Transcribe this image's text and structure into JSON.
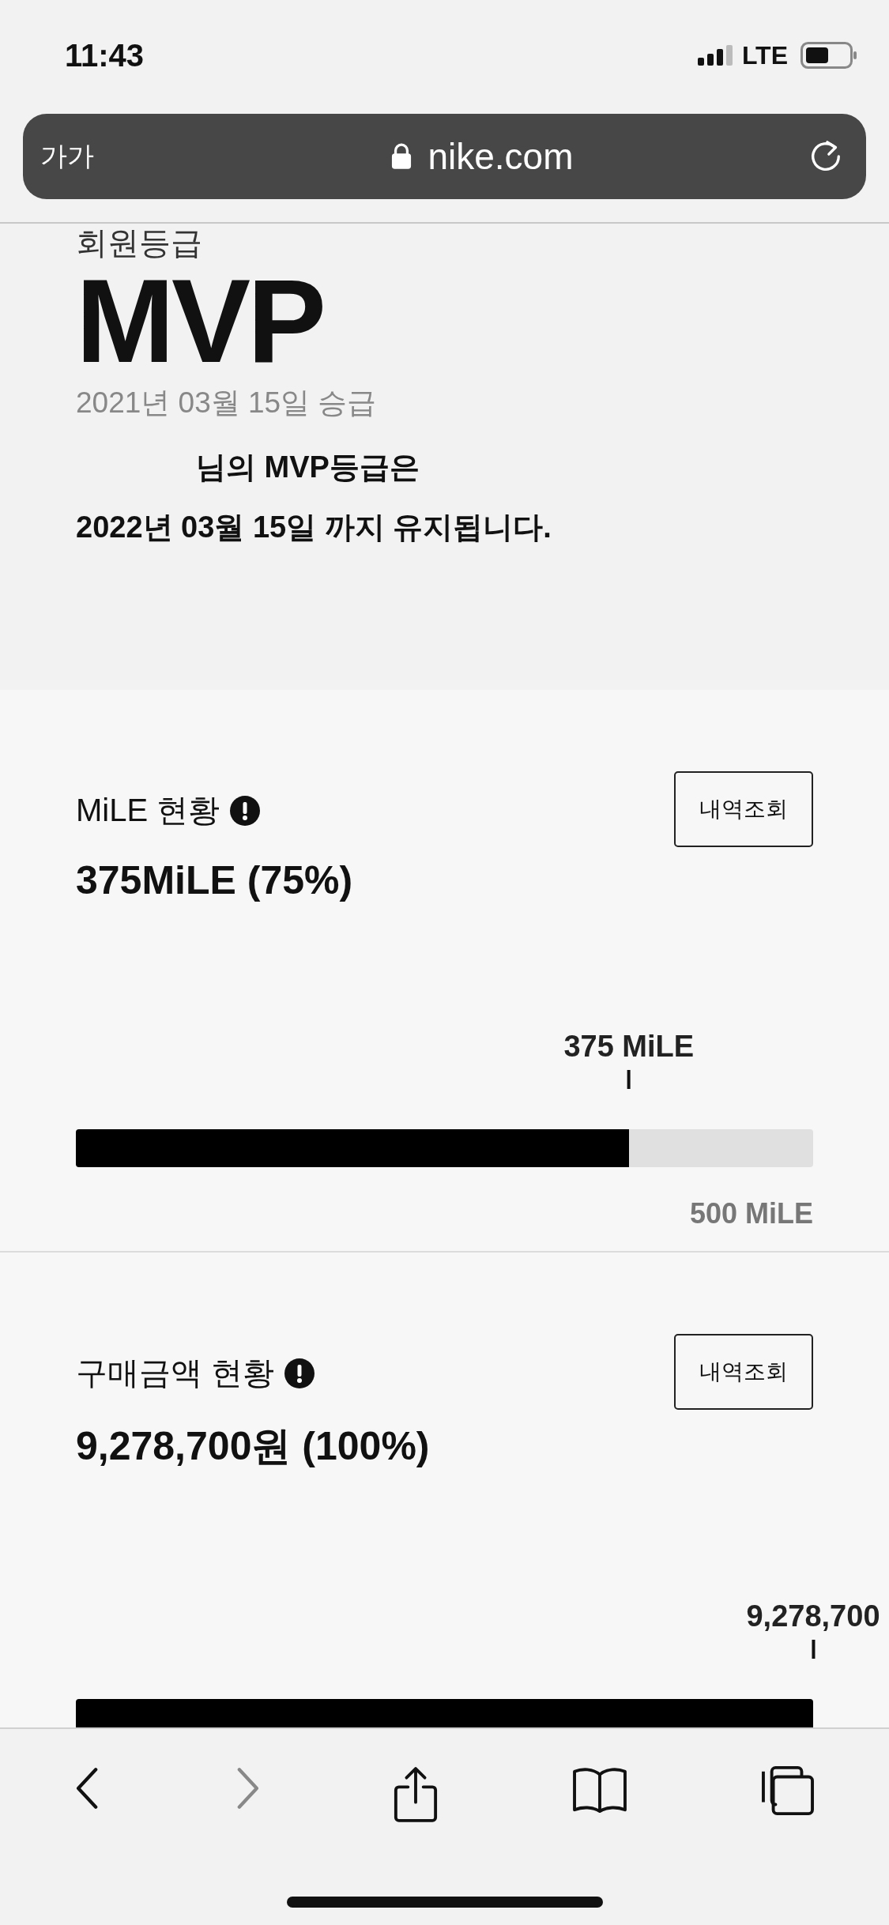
{
  "status_bar": {
    "time": "11:43",
    "network": "LTE"
  },
  "address_bar": {
    "text_size": "가가",
    "url": "nike.com"
  },
  "membership": {
    "label": "회원등급",
    "grade": "MVP",
    "promoted": "2021년 03월 15일 승급",
    "notice": "님의 MVP등급은\n2022년 03월 15일 까지 유지됩니다."
  },
  "meters": [
    {
      "title": "MiLE 현황",
      "button": "내역조회",
      "amount": "375MiLE (75%)",
      "marker": "375 MiLE",
      "level": 0.75,
      "max": "500 MiLE"
    },
    {
      "title": "구매금액 현황",
      "button": "내역조회",
      "amount": "9,278,700원 (100%)",
      "marker": "9,278,700",
      "level": 1
    }
  ],
  "toolbar": [
    {
      "kind": "back",
      "disabled": false
    },
    {
      "kind": "forward",
      "disabled": true
    },
    {
      "kind": "share",
      "disabled": false
    },
    {
      "kind": "bookmarks",
      "disabled": false
    },
    {
      "kind": "tabs",
      "disabled": false
    }
  ]
}
